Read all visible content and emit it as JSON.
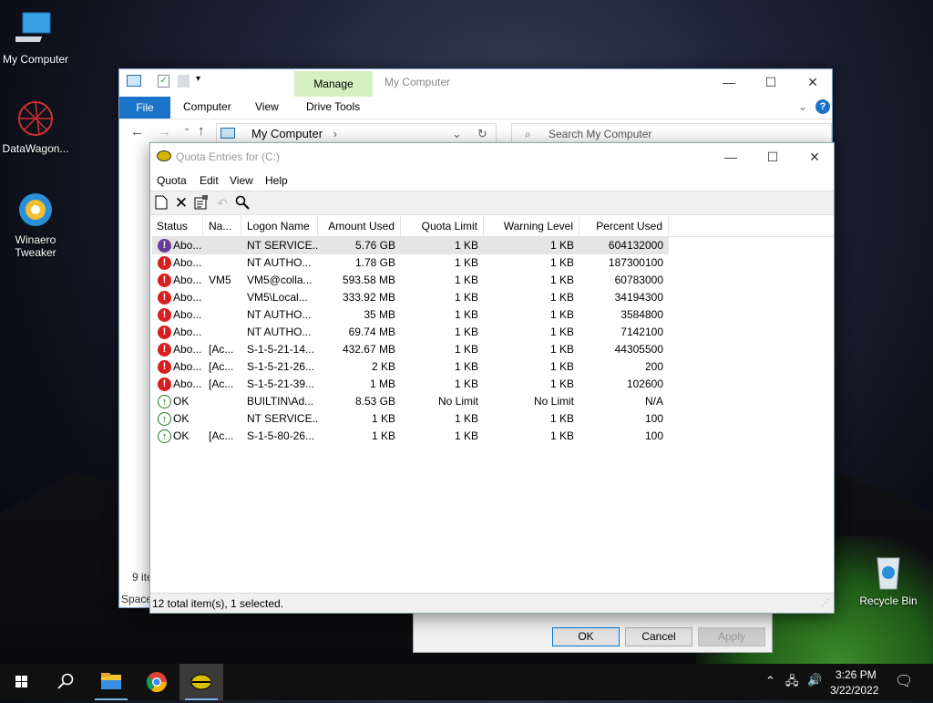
{
  "desktop": {
    "icons": [
      {
        "label": "My Computer",
        "icon": "computer-icon"
      },
      {
        "label": "DataWagon...",
        "icon": "datawagon-icon"
      },
      {
        "label": "Winaero Tweaker",
        "icon": "winaero-tweaker-icon"
      },
      {
        "label": "Recycle Bin",
        "icon": "recycle-bin-icon"
      }
    ]
  },
  "explorer": {
    "title": "My Computer",
    "manage_tab": "Manage",
    "tabs": [
      "File",
      "Computer",
      "View",
      "Drive Tools"
    ],
    "address": "My Computer",
    "search_placeholder": "Search My Computer",
    "status_items": "9 ite",
    "status_space": "Space",
    "dialog_buttons": {
      "ok": "OK",
      "cancel": "Cancel",
      "apply": "Apply"
    },
    "accent_color": "#1a73c8"
  },
  "quota": {
    "title": "Quota Entries for  (C:)",
    "menu": [
      "Quota",
      "Edit",
      "View",
      "Help"
    ],
    "toolbar": [
      "new-entry-icon",
      "delete-icon",
      "properties-icon",
      "undo-icon",
      "find-icon"
    ],
    "columns": [
      "Status",
      "Na...",
      "Logon Name",
      "Amount Used",
      "Quota Limit",
      "Warning Level",
      "Percent Used"
    ],
    "rows": [
      {
        "status_icon": "warning-purple-icon",
        "status": "Abo...",
        "name": "",
        "logon": "NT SERVICE...",
        "used": "5.76 GB",
        "limit": "1 KB",
        "warn": "1 KB",
        "pct": "604132000",
        "selected": true
      },
      {
        "status_icon": "error-icon",
        "status": "Abo...",
        "name": "",
        "logon": "NT AUTHO...",
        "used": "1.78 GB",
        "limit": "1 KB",
        "warn": "1 KB",
        "pct": "187300100"
      },
      {
        "status_icon": "error-icon",
        "status": "Abo...",
        "name": "VM5",
        "logon": "VM5@colla...",
        "used": "593.58 MB",
        "limit": "1 KB",
        "warn": "1 KB",
        "pct": "60783000"
      },
      {
        "status_icon": "error-icon",
        "status": "Abo...",
        "name": "",
        "logon": "VM5\\Local...",
        "used": "333.92 MB",
        "limit": "1 KB",
        "warn": "1 KB",
        "pct": "34194300"
      },
      {
        "status_icon": "error-icon",
        "status": "Abo...",
        "name": "",
        "logon": "NT AUTHO...",
        "used": "35 MB",
        "limit": "1 KB",
        "warn": "1 KB",
        "pct": "3584800"
      },
      {
        "status_icon": "error-icon",
        "status": "Abo...",
        "name": "",
        "logon": "NT AUTHO...",
        "used": "69.74 MB",
        "limit": "1 KB",
        "warn": "1 KB",
        "pct": "7142100"
      },
      {
        "status_icon": "error-icon",
        "status": "Abo...",
        "name": "[Ac...",
        "logon": "S-1-5-21-14...",
        "used": "432.67 MB",
        "limit": "1 KB",
        "warn": "1 KB",
        "pct": "44305500"
      },
      {
        "status_icon": "error-icon",
        "status": "Abo...",
        "name": "[Ac...",
        "logon": "S-1-5-21-26...",
        "used": "2 KB",
        "limit": "1 KB",
        "warn": "1 KB",
        "pct": "200"
      },
      {
        "status_icon": "error-icon",
        "status": "Abo...",
        "name": "[Ac...",
        "logon": "S-1-5-21-39...",
        "used": "1 MB",
        "limit": "1 KB",
        "warn": "1 KB",
        "pct": "102600"
      },
      {
        "status_icon": "ok-icon",
        "status": "OK",
        "name": "",
        "logon": "BUILTIN\\Ad...",
        "used": "8.53 GB",
        "limit": "No Limit",
        "warn": "No Limit",
        "pct": "N/A"
      },
      {
        "status_icon": "ok-icon",
        "status": "OK",
        "name": "",
        "logon": "NT SERVICE...",
        "used": "1 KB",
        "limit": "1 KB",
        "warn": "1 KB",
        "pct": "100"
      },
      {
        "status_icon": "ok-icon",
        "status": "OK",
        "name": "[Ac...",
        "logon": "S-1-5-80-26...",
        "used": "1 KB",
        "limit": "1 KB",
        "warn": "1 KB",
        "pct": "100"
      }
    ],
    "status_bar": "12 total item(s), 1 selected."
  },
  "taskbar": {
    "apps": [
      "start-icon",
      "search-icon",
      "file-explorer-icon",
      "chrome-icon",
      "quota-icon"
    ],
    "time": "3:26 PM",
    "date": "3/22/2022"
  }
}
